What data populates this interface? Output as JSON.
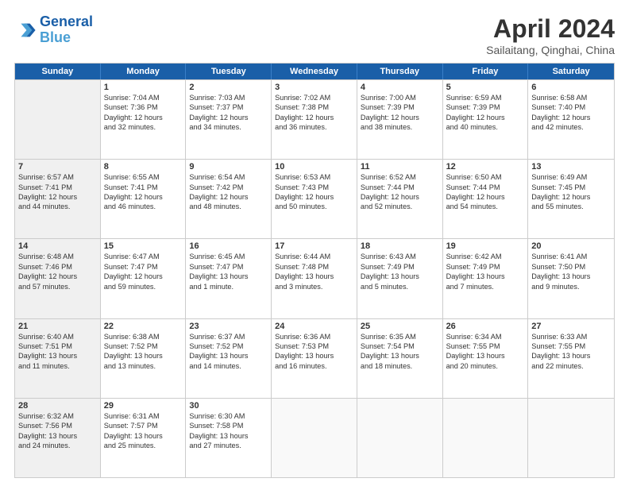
{
  "header": {
    "logo_line1": "General",
    "logo_line2": "Blue",
    "title": "April 2024",
    "subtitle": "Sailaitang, Qinghai, China"
  },
  "days_of_week": [
    "Sunday",
    "Monday",
    "Tuesday",
    "Wednesday",
    "Thursday",
    "Friday",
    "Saturday"
  ],
  "rows": [
    [
      {
        "day": "",
        "lines": [],
        "shaded": true
      },
      {
        "day": "1",
        "lines": [
          "Sunrise: 7:04 AM",
          "Sunset: 7:36 PM",
          "Daylight: 12 hours",
          "and 32 minutes."
        ]
      },
      {
        "day": "2",
        "lines": [
          "Sunrise: 7:03 AM",
          "Sunset: 7:37 PM",
          "Daylight: 12 hours",
          "and 34 minutes."
        ]
      },
      {
        "day": "3",
        "lines": [
          "Sunrise: 7:02 AM",
          "Sunset: 7:38 PM",
          "Daylight: 12 hours",
          "and 36 minutes."
        ]
      },
      {
        "day": "4",
        "lines": [
          "Sunrise: 7:00 AM",
          "Sunset: 7:39 PM",
          "Daylight: 12 hours",
          "and 38 minutes."
        ]
      },
      {
        "day": "5",
        "lines": [
          "Sunrise: 6:59 AM",
          "Sunset: 7:39 PM",
          "Daylight: 12 hours",
          "and 40 minutes."
        ]
      },
      {
        "day": "6",
        "lines": [
          "Sunrise: 6:58 AM",
          "Sunset: 7:40 PM",
          "Daylight: 12 hours",
          "and 42 minutes."
        ]
      }
    ],
    [
      {
        "day": "7",
        "lines": [
          "Sunrise: 6:57 AM",
          "Sunset: 7:41 PM",
          "Daylight: 12 hours",
          "and 44 minutes."
        ],
        "shaded": true
      },
      {
        "day": "8",
        "lines": [
          "Sunrise: 6:55 AM",
          "Sunset: 7:41 PM",
          "Daylight: 12 hours",
          "and 46 minutes."
        ]
      },
      {
        "day": "9",
        "lines": [
          "Sunrise: 6:54 AM",
          "Sunset: 7:42 PM",
          "Daylight: 12 hours",
          "and 48 minutes."
        ]
      },
      {
        "day": "10",
        "lines": [
          "Sunrise: 6:53 AM",
          "Sunset: 7:43 PM",
          "Daylight: 12 hours",
          "and 50 minutes."
        ]
      },
      {
        "day": "11",
        "lines": [
          "Sunrise: 6:52 AM",
          "Sunset: 7:44 PM",
          "Daylight: 12 hours",
          "and 52 minutes."
        ]
      },
      {
        "day": "12",
        "lines": [
          "Sunrise: 6:50 AM",
          "Sunset: 7:44 PM",
          "Daylight: 12 hours",
          "and 54 minutes."
        ]
      },
      {
        "day": "13",
        "lines": [
          "Sunrise: 6:49 AM",
          "Sunset: 7:45 PM",
          "Daylight: 12 hours",
          "and 55 minutes."
        ]
      }
    ],
    [
      {
        "day": "14",
        "lines": [
          "Sunrise: 6:48 AM",
          "Sunset: 7:46 PM",
          "Daylight: 12 hours",
          "and 57 minutes."
        ],
        "shaded": true
      },
      {
        "day": "15",
        "lines": [
          "Sunrise: 6:47 AM",
          "Sunset: 7:47 PM",
          "Daylight: 12 hours",
          "and 59 minutes."
        ]
      },
      {
        "day": "16",
        "lines": [
          "Sunrise: 6:45 AM",
          "Sunset: 7:47 PM",
          "Daylight: 13 hours",
          "and 1 minute."
        ]
      },
      {
        "day": "17",
        "lines": [
          "Sunrise: 6:44 AM",
          "Sunset: 7:48 PM",
          "Daylight: 13 hours",
          "and 3 minutes."
        ]
      },
      {
        "day": "18",
        "lines": [
          "Sunrise: 6:43 AM",
          "Sunset: 7:49 PM",
          "Daylight: 13 hours",
          "and 5 minutes."
        ]
      },
      {
        "day": "19",
        "lines": [
          "Sunrise: 6:42 AM",
          "Sunset: 7:49 PM",
          "Daylight: 13 hours",
          "and 7 minutes."
        ]
      },
      {
        "day": "20",
        "lines": [
          "Sunrise: 6:41 AM",
          "Sunset: 7:50 PM",
          "Daylight: 13 hours",
          "and 9 minutes."
        ]
      }
    ],
    [
      {
        "day": "21",
        "lines": [
          "Sunrise: 6:40 AM",
          "Sunset: 7:51 PM",
          "Daylight: 13 hours",
          "and 11 minutes."
        ],
        "shaded": true
      },
      {
        "day": "22",
        "lines": [
          "Sunrise: 6:38 AM",
          "Sunset: 7:52 PM",
          "Daylight: 13 hours",
          "and 13 minutes."
        ]
      },
      {
        "day": "23",
        "lines": [
          "Sunrise: 6:37 AM",
          "Sunset: 7:52 PM",
          "Daylight: 13 hours",
          "and 14 minutes."
        ]
      },
      {
        "day": "24",
        "lines": [
          "Sunrise: 6:36 AM",
          "Sunset: 7:53 PM",
          "Daylight: 13 hours",
          "and 16 minutes."
        ]
      },
      {
        "day": "25",
        "lines": [
          "Sunrise: 6:35 AM",
          "Sunset: 7:54 PM",
          "Daylight: 13 hours",
          "and 18 minutes."
        ]
      },
      {
        "day": "26",
        "lines": [
          "Sunrise: 6:34 AM",
          "Sunset: 7:55 PM",
          "Daylight: 13 hours",
          "and 20 minutes."
        ]
      },
      {
        "day": "27",
        "lines": [
          "Sunrise: 6:33 AM",
          "Sunset: 7:55 PM",
          "Daylight: 13 hours",
          "and 22 minutes."
        ]
      }
    ],
    [
      {
        "day": "28",
        "lines": [
          "Sunrise: 6:32 AM",
          "Sunset: 7:56 PM",
          "Daylight: 13 hours",
          "and 24 minutes."
        ],
        "shaded": true
      },
      {
        "day": "29",
        "lines": [
          "Sunrise: 6:31 AM",
          "Sunset: 7:57 PM",
          "Daylight: 13 hours",
          "and 25 minutes."
        ]
      },
      {
        "day": "30",
        "lines": [
          "Sunrise: 6:30 AM",
          "Sunset: 7:58 PM",
          "Daylight: 13 hours",
          "and 27 minutes."
        ]
      },
      {
        "day": "",
        "lines": []
      },
      {
        "day": "",
        "lines": []
      },
      {
        "day": "",
        "lines": []
      },
      {
        "day": "",
        "lines": []
      }
    ]
  ]
}
